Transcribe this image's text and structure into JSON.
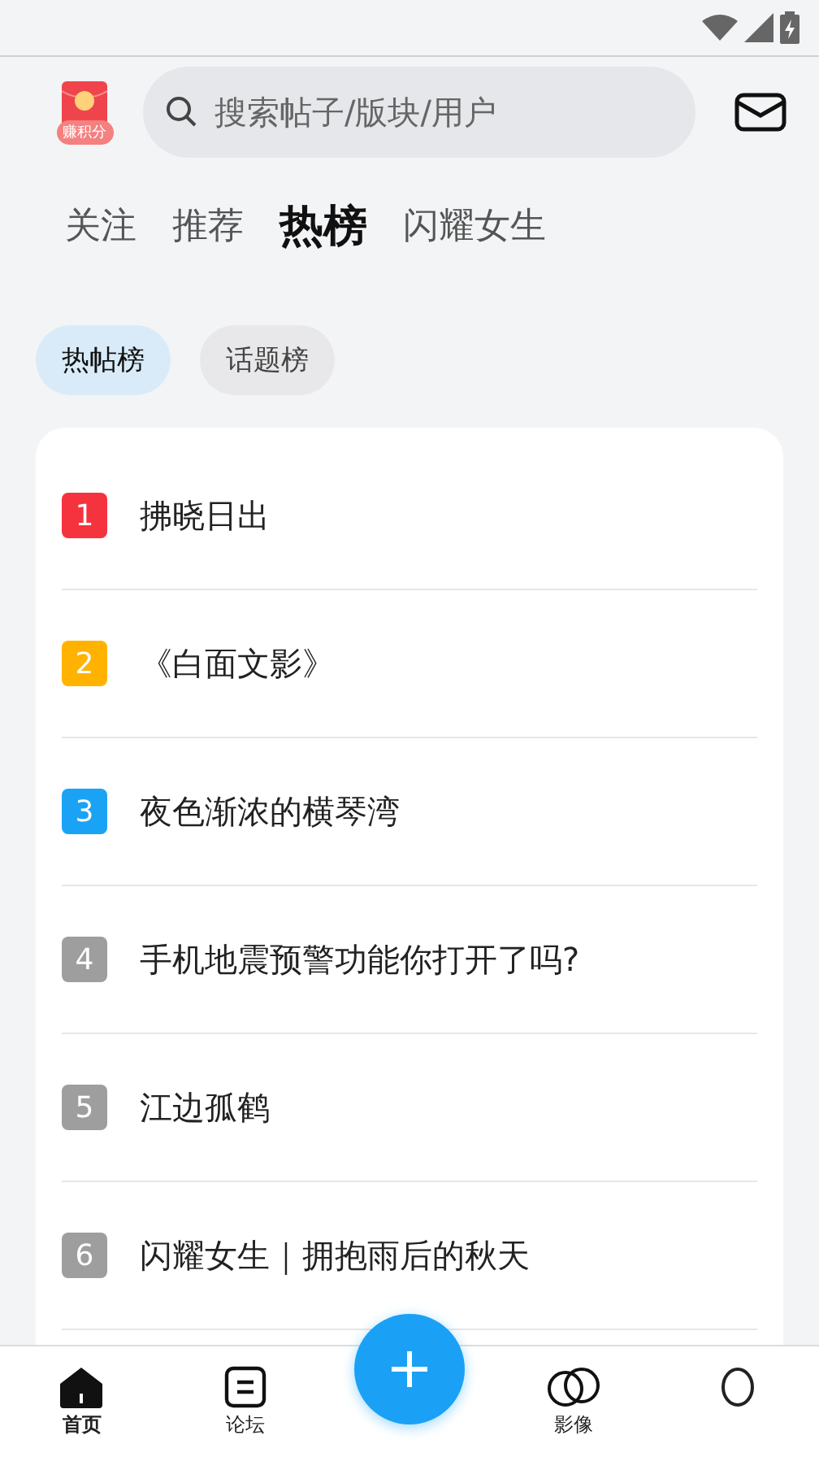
{
  "header": {
    "reward_label": "赚积分",
    "search": {
      "placeholder": "搜索帖子/版块/用户"
    }
  },
  "tabs": [
    {
      "label": "关注",
      "selected": false
    },
    {
      "label": "推荐",
      "selected": false
    },
    {
      "label": "热榜",
      "selected": true
    },
    {
      "label": "闪耀女生",
      "selected": false
    }
  ],
  "chips": [
    {
      "label": "热帖榜",
      "selected": true
    },
    {
      "label": "话题榜",
      "selected": false
    }
  ],
  "hot_list": [
    {
      "rank": "1",
      "color": "#f5333f",
      "title": "拂晓日出"
    },
    {
      "rank": "2",
      "color": "#ffb300",
      "title": "《白面文影》"
    },
    {
      "rank": "3",
      "color": "#1aa3f5",
      "title": "夜色渐浓的横琴湾"
    },
    {
      "rank": "4",
      "color": "#9e9e9e",
      "title": "手机地震预警功能你打开了吗?"
    },
    {
      "rank": "5",
      "color": "#9e9e9e",
      "title": "江边孤鹤"
    },
    {
      "rank": "6",
      "color": "#9e9e9e",
      "title": "闪耀女生｜拥抱雨后的秋天"
    }
  ],
  "bottom_nav": [
    {
      "kind": "home",
      "label": "首页",
      "selected": true
    },
    {
      "kind": "forum",
      "label": "论坛",
      "selected": false
    },
    {
      "kind": "add"
    },
    {
      "kind": "image",
      "label": "影像",
      "selected": false
    },
    {
      "kind": "profile",
      "selected": false
    }
  ]
}
